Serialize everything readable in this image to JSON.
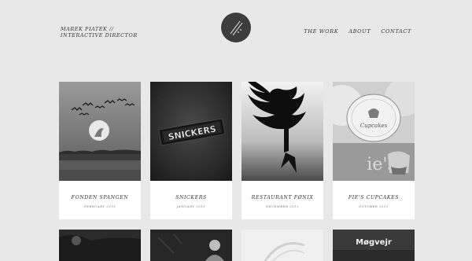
{
  "header": {
    "brand_line1": "MAREK PIATEK //",
    "brand_line2": "INTERACTIVE DIRECTOR",
    "logo_icon": "slash-dots-logo-icon",
    "nav": [
      {
        "label": "THE WORK"
      },
      {
        "label": "ABOUT"
      },
      {
        "label": "CONTACT"
      }
    ]
  },
  "projects": [
    {
      "title": "FONDEN SPANGEN",
      "date": "FEBRUARY 2013",
      "image": "birds-landscape-image"
    },
    {
      "title": "SNICKERS",
      "date": "JANUARY 2013",
      "image": "snickers-bar-image"
    },
    {
      "title": "RESTAURANT FØNIX",
      "date": "DECEMBER 2012",
      "image": "phoenix-logo-image"
    },
    {
      "title": "FIE'S CUPCAKES",
      "date": "OCTOBER 2012",
      "image": "cupcakes-image"
    }
  ],
  "second_row": [
    {
      "image": "dark-photo-image"
    },
    {
      "image": "person-photo-image"
    },
    {
      "image": "light-abstract-image"
    },
    {
      "image": "mogvejr-image",
      "overlay_text": "Møgvejr"
    }
  ]
}
